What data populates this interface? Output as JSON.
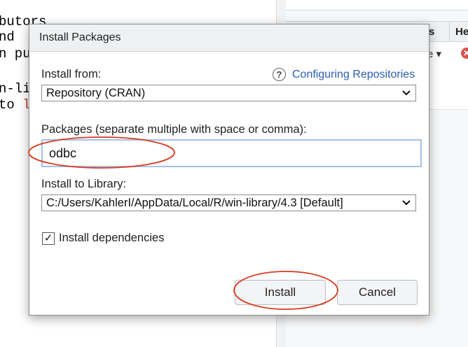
{
  "background": {
    "console_lines": [
      {
        "text": "butors",
        "highlight": ""
      },
      {
        "text": "nd",
        "highlight": ""
      },
      {
        "text": "n pu",
        "highlight": ""
      },
      {
        "text": "",
        "highlight": ""
      },
      {
        "text": "n-lir",
        "highlight": ""
      },
      {
        "text": "to ",
        "highlight": "l"
      }
    ],
    "right_pane": {
      "tab_partial_1": "s",
      "tab_partial_2": "He",
      "toolbar_fragment": "e ▾",
      "stop_glyph": "✕"
    }
  },
  "dialog": {
    "title": "Install Packages",
    "install_from_label": "Install from:",
    "help_icon_glyph": "?",
    "help_link": "Configuring Repositories",
    "repository_value": "Repository (CRAN)",
    "packages_label": "Packages (separate multiple with space or comma):",
    "packages_value": "odbc",
    "library_label": "Install to Library:",
    "library_value": "C:/Users/KahlerI/AppData/Local/R/win-library/4.3 [Default]",
    "dependencies_checked": true,
    "dependencies_check_glyph": "✓",
    "dependencies_label": "Install dependencies",
    "install_button": "Install",
    "cancel_button": "Cancel"
  },
  "annotations": {
    "color": "#d9391f"
  }
}
